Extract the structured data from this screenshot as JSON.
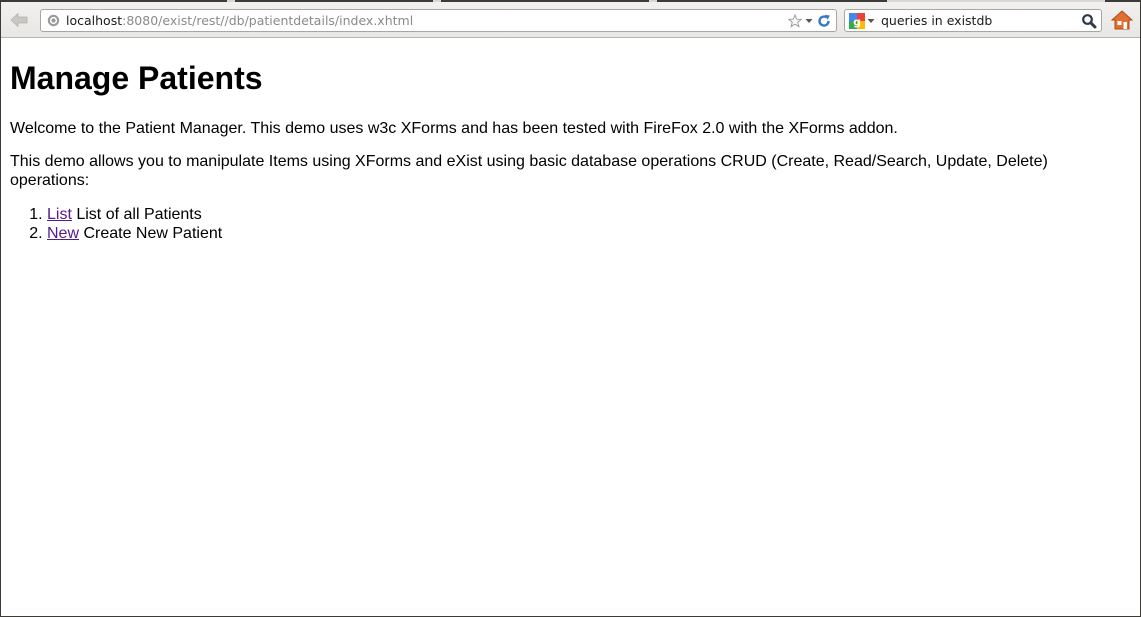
{
  "browser": {
    "url_host": "localhost",
    "url_rest": ":8080/exist/rest//db/patientdetails/index.xhtml",
    "search_query": "queries in existdb",
    "icons": {
      "back": "back-arrow-icon",
      "site": "globe-icon",
      "bookmark": "star-icon",
      "history": "dropdown-arrow-icon",
      "reload": "reload-icon",
      "search_engine": "google-icon",
      "search_go": "magnifier-icon",
      "home": "home-icon"
    }
  },
  "page": {
    "title": "Manage Patients",
    "intro": "Welcome to the Patient Manager. This demo uses w3c XForms and has been tested with FireFox 2.0 with the XForms addon.",
    "description": "This demo allows you to manipulate Items using XForms and eXist using basic database operations CRUD (Create, Read/Search, Update, Delete) operations:",
    "links": [
      {
        "link_text": "List",
        "text": " List of all Patients"
      },
      {
        "link_text": "New",
        "text": " Create New Patient"
      }
    ],
    "link_color": "#551a8b"
  }
}
